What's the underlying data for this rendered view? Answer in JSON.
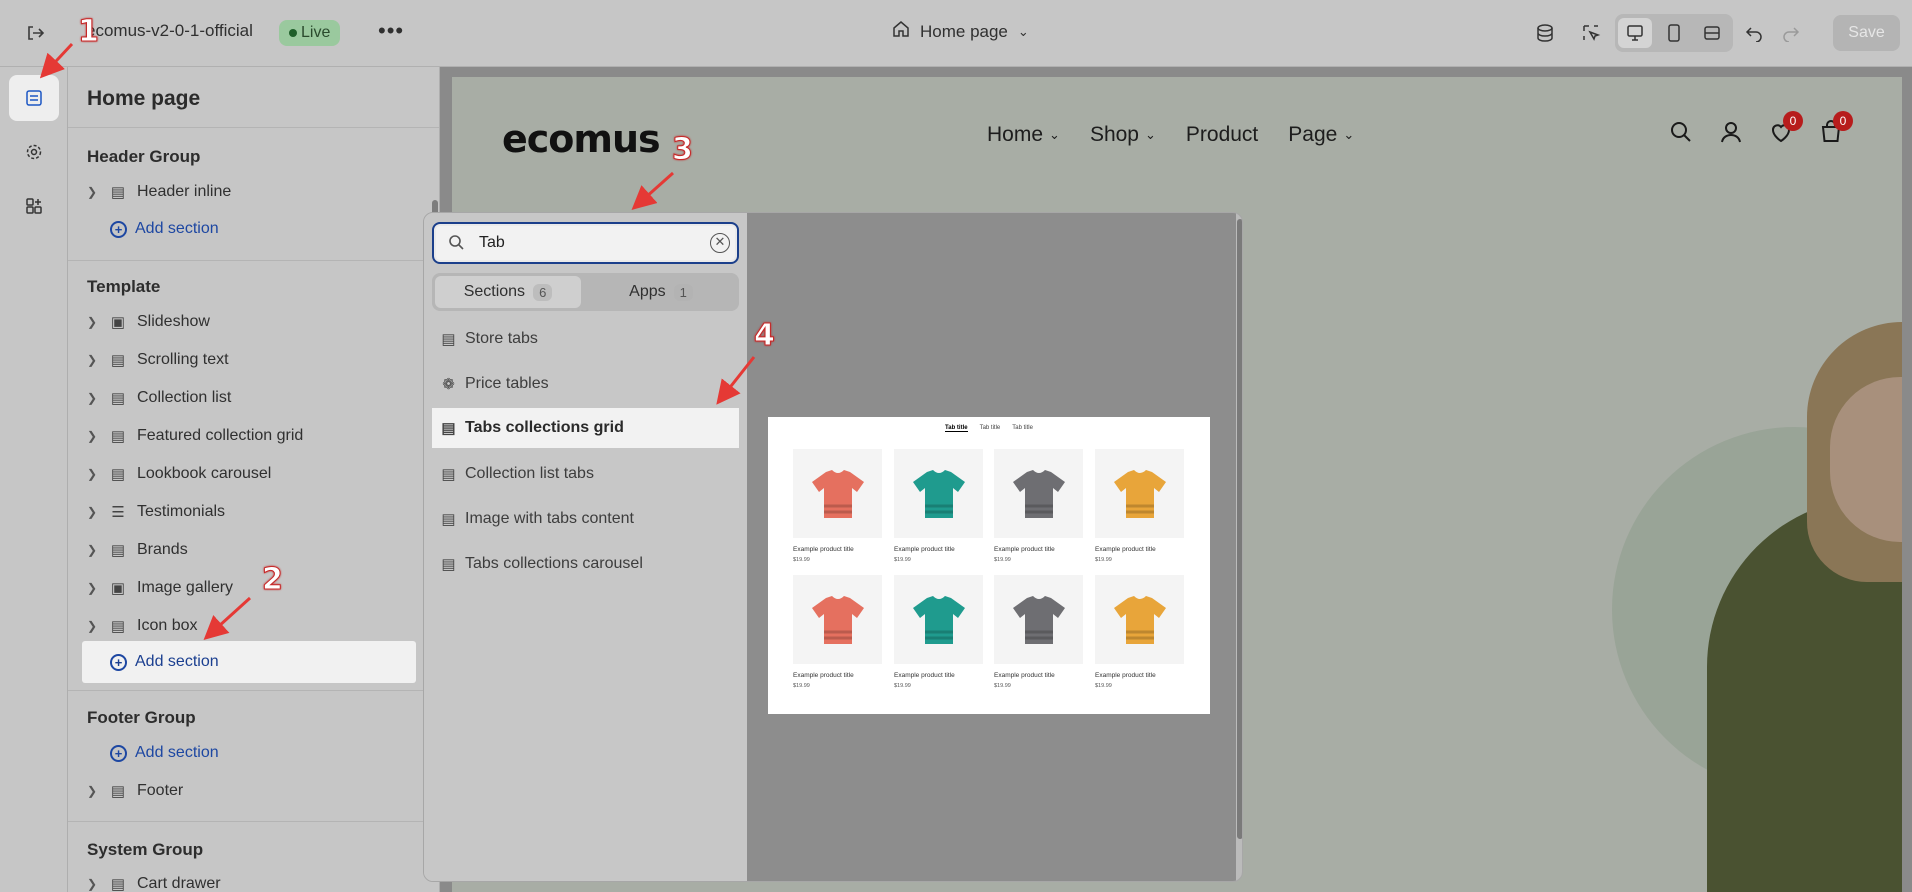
{
  "topbar": {
    "store_name": "ecomus-v2-0-1-official",
    "live_label": "Live",
    "page_select": "Home page",
    "save_label": "Save"
  },
  "sidebar": {
    "title": "Home page",
    "header_group": {
      "title": "Header Group",
      "items": [
        {
          "label": "Header inline",
          "icon": "header-icon"
        }
      ],
      "add_label": "Add section"
    },
    "template": {
      "title": "Template",
      "items": [
        {
          "label": "Slideshow",
          "icon": "slideshow-icon"
        },
        {
          "label": "Scrolling text",
          "icon": "text-icon"
        },
        {
          "label": "Collection list",
          "icon": "section-icon"
        },
        {
          "label": "Featured collection grid",
          "icon": "section-icon"
        },
        {
          "label": "Lookbook carousel",
          "icon": "section-icon"
        },
        {
          "label": "Testimonials",
          "icon": "testimonials-icon"
        },
        {
          "label": "Brands",
          "icon": "section-icon"
        },
        {
          "label": "Image gallery",
          "icon": "image-icon"
        },
        {
          "label": "Icon box",
          "icon": "section-icon"
        }
      ],
      "add_label": "Add section"
    },
    "footer_group": {
      "title": "Footer Group",
      "add_label": "Add section",
      "items": [
        {
          "label": "Footer",
          "icon": "footer-icon"
        }
      ]
    },
    "system_group": {
      "title": "System Group",
      "items": [
        {
          "label": "Cart drawer",
          "icon": "section-icon"
        }
      ]
    }
  },
  "picker": {
    "search_value": "Tab",
    "tabs": [
      {
        "label": "Sections",
        "count": "6"
      },
      {
        "label": "Apps",
        "count": "1"
      }
    ],
    "items": [
      {
        "label": "Store tabs"
      },
      {
        "label": "Price tables"
      },
      {
        "label": "Tabs collections grid"
      },
      {
        "label": "Collection list tabs"
      },
      {
        "label": "Image with tabs content"
      },
      {
        "label": "Tabs collections carousel"
      }
    ],
    "preview": {
      "tabs": [
        "Tab title",
        "Tab title",
        "Tab title"
      ],
      "product_title": "Example product title",
      "product_price": "$19.99",
      "tee_colors": [
        "#e5705f",
        "#1f9b8e",
        "#6e6e72",
        "#e8a53a"
      ]
    }
  },
  "storefront": {
    "logo": "ecomus",
    "nav": [
      {
        "label": "Home"
      },
      {
        "label": "Shop"
      },
      {
        "label": "Product"
      },
      {
        "label": "Page"
      }
    ],
    "wishlist_count": "0",
    "cart_count": "0"
  },
  "annotations": [
    "1",
    "2",
    "3",
    "4"
  ],
  "colors": {
    "accent": "#1b3f8b",
    "annotation": "#e53935"
  }
}
